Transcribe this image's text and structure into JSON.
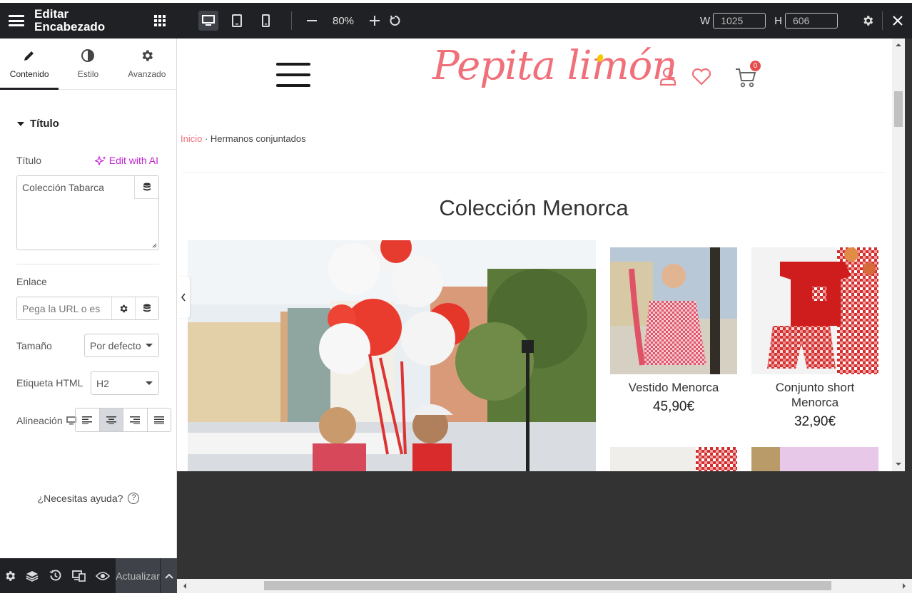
{
  "panel": {
    "title": "Editar Encabezado",
    "tabs": [
      {
        "label": "Contenido",
        "icon": "pencil-icon"
      },
      {
        "label": "Estilo",
        "icon": "half-circle-icon"
      },
      {
        "label": "Avanzado",
        "icon": "gear-icon"
      }
    ],
    "section_title": "Título",
    "title_label": "Título",
    "edit_ai": "Edit with AI",
    "title_value": "Colección Tabarca",
    "link_label": "Enlace",
    "link_placeholder": "Pega la URL o es",
    "size_label": "Tamaño",
    "size_value": "Por defecto",
    "html_tag_label": "Etiqueta HTML",
    "html_tag_value": "H2",
    "align_label": "Alineación",
    "help_text": "¿Necesitas ayuda?",
    "help_icon": "?"
  },
  "toolbar": {
    "zoom": "80%",
    "width_label": "W",
    "width_value": "1025",
    "height_label": "H",
    "height_value": "606"
  },
  "bottom": {
    "update_label": "Actualizar"
  },
  "site": {
    "logo": "Pepita limón",
    "cart_count": "0",
    "breadcrumb_home": "Inicio",
    "breadcrumb_sep": " · ",
    "breadcrumb_current": "Hermanos conjuntados",
    "heading": "Colección Menorca",
    "products": [
      {
        "name": "Vestido Menorca",
        "price": "45,90€"
      },
      {
        "name": "Conjunto short Menorca",
        "price": "32,90€"
      }
    ]
  },
  "colors": {
    "brand_pink": "#f0707a",
    "ai_purple": "#c026d3",
    "editor_dark": "#1f2124"
  }
}
